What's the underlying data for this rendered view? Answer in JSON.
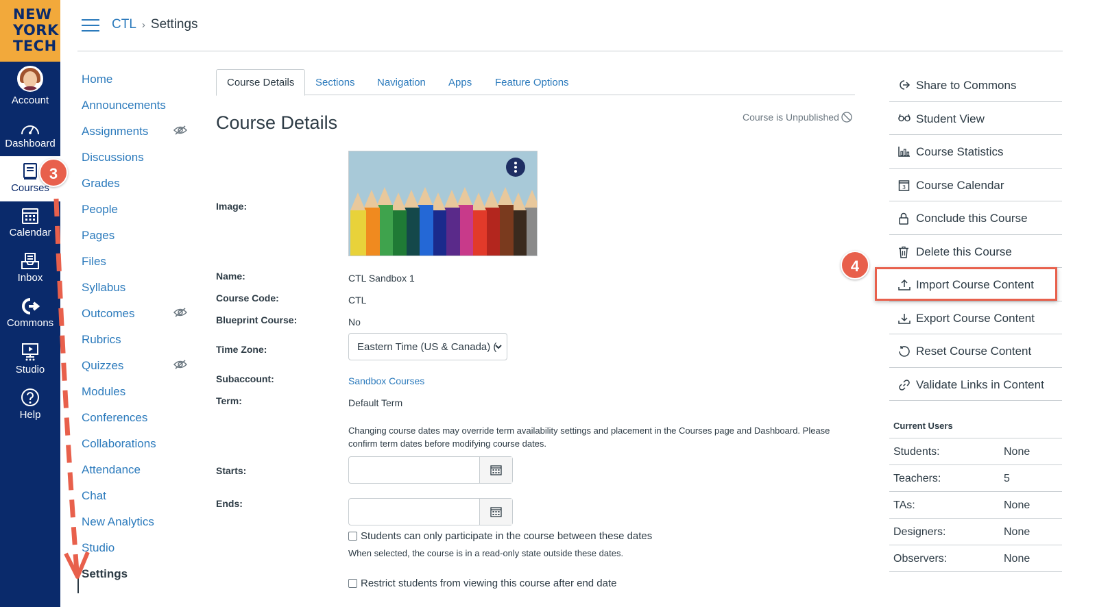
{
  "brand": {
    "logo_lines": [
      "NEW",
      "YORK",
      "TECH"
    ]
  },
  "global_nav": [
    {
      "label": "Account",
      "icon": "avatar"
    },
    {
      "label": "Dashboard",
      "icon": "dashboard-icon"
    },
    {
      "label": "Courses",
      "icon": "courses-icon",
      "active": true
    },
    {
      "label": "Calendar",
      "icon": "calendar-icon"
    },
    {
      "label": "Inbox",
      "icon": "inbox-icon"
    },
    {
      "label": "Commons",
      "icon": "commons-icon"
    },
    {
      "label": "Studio",
      "icon": "studio-icon"
    },
    {
      "label": "Help",
      "icon": "help-icon"
    }
  ],
  "breadcrumb": {
    "course": "CTL",
    "sep": "›",
    "current": "Settings"
  },
  "course_nav": [
    {
      "label": "Home"
    },
    {
      "label": "Announcements"
    },
    {
      "label": "Assignments",
      "hidden": true
    },
    {
      "label": "Discussions"
    },
    {
      "label": "Grades"
    },
    {
      "label": "People"
    },
    {
      "label": "Pages"
    },
    {
      "label": "Files"
    },
    {
      "label": "Syllabus"
    },
    {
      "label": "Outcomes",
      "hidden": true
    },
    {
      "label": "Rubrics"
    },
    {
      "label": "Quizzes",
      "hidden": true
    },
    {
      "label": "Modules"
    },
    {
      "label": "Conferences"
    },
    {
      "label": "Collaborations"
    },
    {
      "label": "Attendance"
    },
    {
      "label": "Chat"
    },
    {
      "label": "New Analytics"
    },
    {
      "label": "Studio"
    },
    {
      "label": "Settings",
      "active": true
    }
  ],
  "tabs": [
    "Course Details",
    "Sections",
    "Navigation",
    "Apps",
    "Feature Options"
  ],
  "details": {
    "title": "Course Details",
    "publish_status": "Course is Unpublished",
    "image_label": "Image:",
    "name_label": "Name:",
    "name_value": "CTL Sandbox 1",
    "code_label": "Course Code:",
    "code_value": "CTL",
    "blueprint_label": "Blueprint Course:",
    "blueprint_value": "No",
    "timezone_label": "Time Zone:",
    "timezone_value": "Eastern Time (US & Canada) (-",
    "subaccount_label": "Subaccount:",
    "subaccount_value": "Sandbox Courses",
    "term_label": "Term:",
    "term_value": "Default Term",
    "dates_note": "Changing course dates may override term availability settings and placement in the Courses page and Dashboard. Please confirm term dates before modifying course dates.",
    "starts_label": "Starts:",
    "ends_label": "Ends:",
    "participate_checkbox": "Students can only participate in the course between these dates",
    "participate_hint": "When selected, the course is in a read-only state outside these dates.",
    "restrict_checkbox": "Restrict students from viewing this course after end date"
  },
  "pencil_colors": [
    "#e8d23a",
    "#f08a1f",
    "#3fa34d",
    "#1f7a35",
    "#14484a",
    "#2468d6",
    "#1a2a8c",
    "#5a2a8a",
    "#c83a8a",
    "#e23a2a",
    "#b3261e",
    "#7a3a1e",
    "#3a2a1e",
    "#8a8a8a"
  ],
  "sidebar_actions": [
    {
      "label": "Share to Commons",
      "icon": "share-commons-icon"
    },
    {
      "label": "Student View",
      "icon": "student-view-icon"
    },
    {
      "label": "Course Statistics",
      "icon": "statistics-icon"
    },
    {
      "label": "Course Calendar",
      "icon": "calendar-icon"
    },
    {
      "label": "Conclude this Course",
      "icon": "lock-icon"
    },
    {
      "label": "Delete this Course",
      "icon": "trash-icon"
    },
    {
      "label": "Import Course Content",
      "icon": "upload-icon"
    },
    {
      "label": "Export Course Content",
      "icon": "download-icon"
    },
    {
      "label": "Reset Course Content",
      "icon": "reset-icon"
    },
    {
      "label": "Validate Links in Content",
      "icon": "link-icon"
    }
  ],
  "current_users": {
    "heading": "Current Users",
    "rows": [
      {
        "role": "Students:",
        "count": "None"
      },
      {
        "role": "Teachers:",
        "count": "5"
      },
      {
        "role": "TAs:",
        "count": "None"
      },
      {
        "role": "Designers:",
        "count": "None"
      },
      {
        "role": "Observers:",
        "count": "None"
      }
    ]
  },
  "annotations": {
    "step3": "3",
    "step4": "4"
  },
  "colors": {
    "nav_bg": "#0a2a6b",
    "brand": "#f2a93b",
    "link": "#2b7abc",
    "annotation": "#e8604c"
  }
}
